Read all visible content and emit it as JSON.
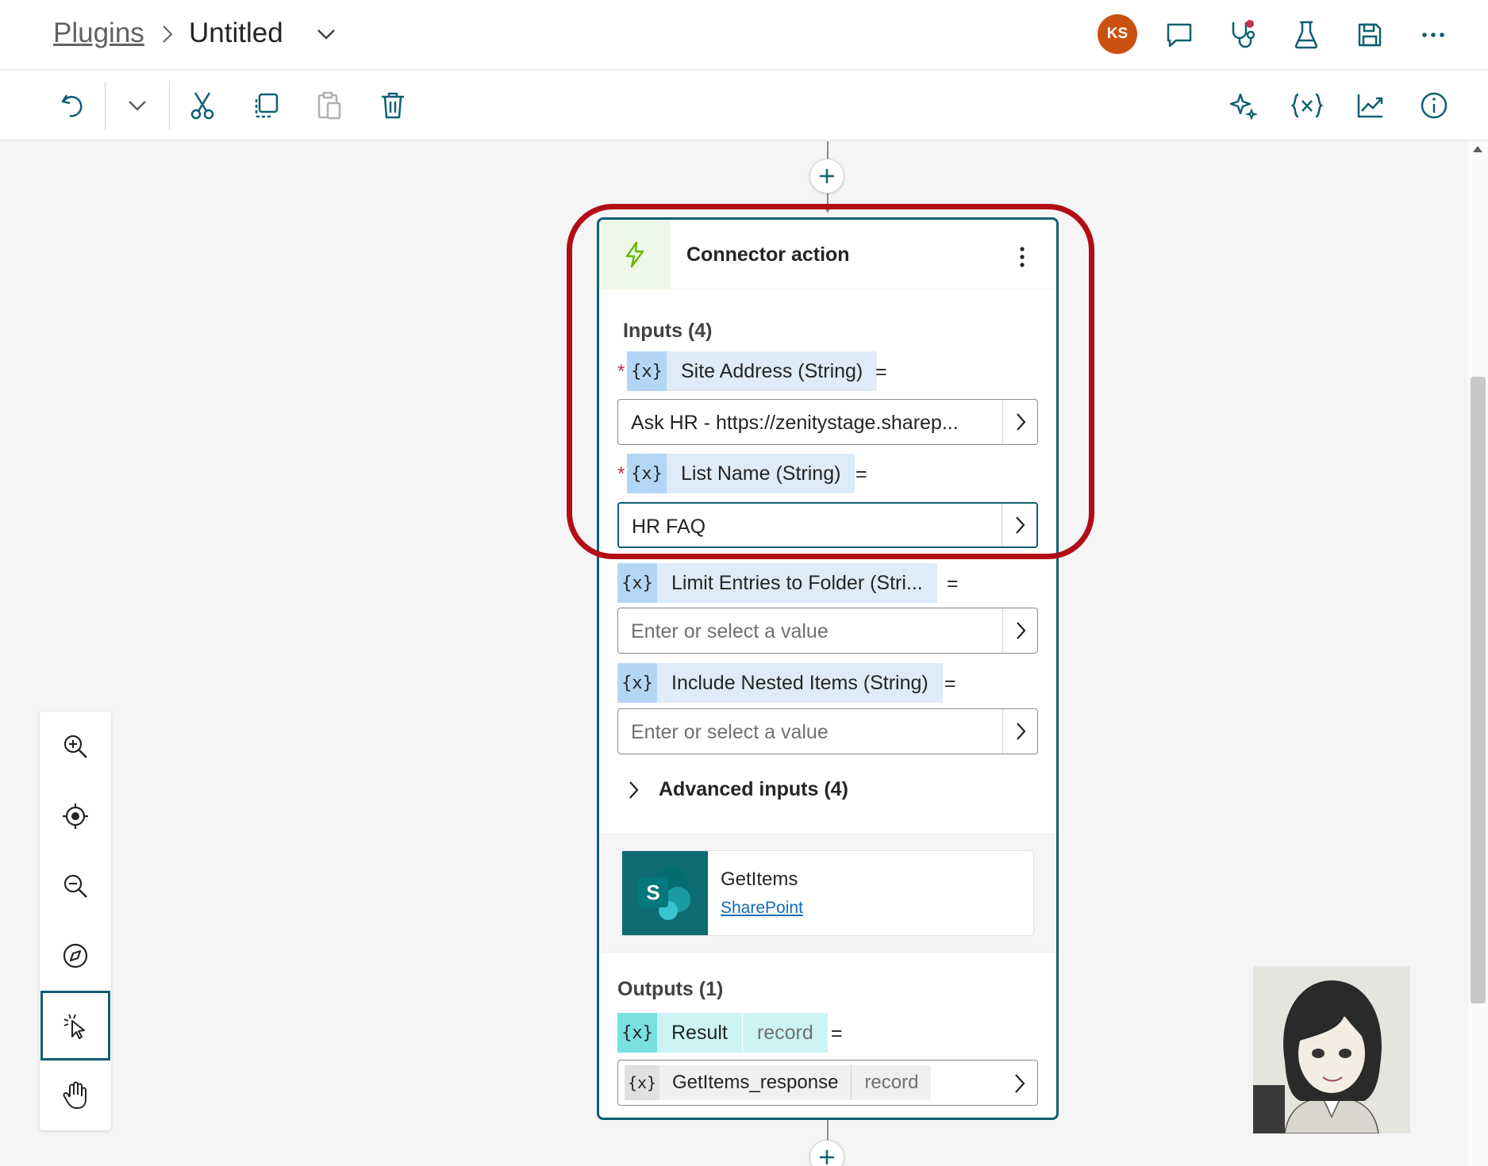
{
  "header": {
    "breadcrumb_root": "Plugins",
    "breadcrumb_current": "Untitled",
    "avatar_initials": "KS",
    "icons": [
      "comment-icon",
      "stethoscope-icon",
      "flask-icon",
      "save-icon",
      "more-icon"
    ]
  },
  "toolbar": {
    "left_icons": [
      "undo-icon",
      "chevron-down-icon",
      "cut-icon",
      "copy-icon",
      "paste-icon",
      "delete-icon"
    ],
    "right_icons": [
      "sparkle-icon",
      "variables-icon",
      "analytics-icon",
      "info-icon"
    ]
  },
  "node": {
    "title": "Connector action",
    "inputs_label": "Inputs (4)",
    "var_glyph": "{x}",
    "equals": "=",
    "inputs": [
      {
        "name": "Site Address (String)",
        "required": "*",
        "value": "Ask HR - https://zenitystage.sharep..."
      },
      {
        "name": "List Name (String)",
        "required": "*",
        "value": "HR FAQ"
      },
      {
        "name": "Limit Entries to Folder (Stri...",
        "placeholder": "Enter or select a value"
      },
      {
        "name": "Include Nested Items (String)",
        "placeholder": "Enter or select a value"
      }
    ],
    "advanced_label": "Advanced inputs (4)",
    "action": {
      "name": "GetItems",
      "connector": "SharePoint",
      "logo_letter": "S"
    },
    "outputs_label": "Outputs (1)",
    "output": {
      "name": "Result",
      "type": "record",
      "value_name": "GetItems_response",
      "value_type": "record"
    }
  },
  "zoom_panel": [
    "zoom-in-icon",
    "fit-view-icon",
    "zoom-out-icon",
    "minimap-icon",
    "select-pointer-icon",
    "pan-hand-icon"
  ],
  "colors": {
    "accent": "#0f5f73",
    "highlight": "#b30d17",
    "avatar": "#ca5010",
    "sharepoint": "#0f6b73"
  }
}
